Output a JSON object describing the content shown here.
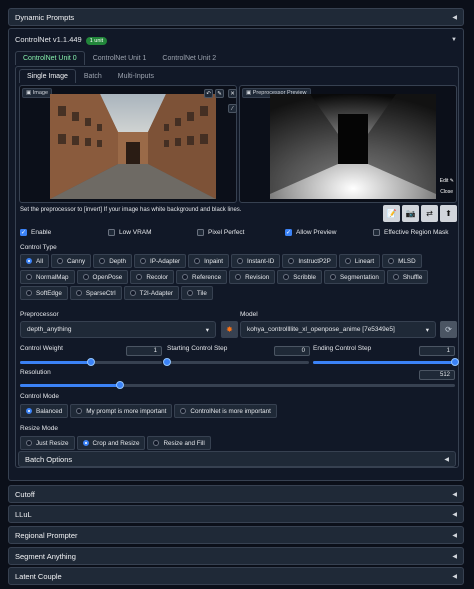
{
  "sections": {
    "dynamic_prompts": "Dynamic Prompts",
    "batch_options": "Batch Options",
    "cutoff": "Cutoff",
    "llul": "LLuL",
    "regional_prompter": "Regional Prompter",
    "segment_anything": "Segment Anything",
    "latent_couple": "Latent Couple"
  },
  "controlnet": {
    "title": "ControlNet v1.1.449",
    "badge": "1 unit",
    "units": [
      "ControlNet Unit 0",
      "ControlNet Unit 1",
      "ControlNet Unit 2"
    ],
    "input_tabs": [
      "Single Image",
      "Batch",
      "Multi-Inputs"
    ],
    "image_label": "Image",
    "preview_label": "Preprocessor Preview",
    "edit_label": "Edit",
    "close_label": "Close",
    "hint": "Set the preprocessor to [invert] If your image has white background and black lines.",
    "checks": {
      "enable": "Enable",
      "low_vram": "Low VRAM",
      "pixel_perfect": "Pixel Perfect",
      "allow_preview": "Allow Preview",
      "effective_region_mask": "Effective Region Mask"
    },
    "control_type_label": "Control Type",
    "control_types": [
      "All",
      "Canny",
      "Depth",
      "IP-Adapter",
      "Inpaint",
      "Instant-ID",
      "InstructP2P",
      "Lineart",
      "MLSD",
      "NormalMap",
      "OpenPose",
      "Recolor",
      "Reference",
      "Revision",
      "Scribble",
      "Segmentation",
      "Shuffle",
      "SoftEdge",
      "SparseCtrl",
      "T2I-Adapter",
      "Tile"
    ],
    "selected_control_type": "All",
    "preprocessor_label": "Preprocessor",
    "preprocessor_value": "depth_anything",
    "model_label": "Model",
    "model_value": "kohya_controllllite_xl_openpose_anime [7e5349e5]",
    "control_weight_label": "Control Weight",
    "control_weight": "1",
    "start_step_label": "Starting Control Step",
    "start_step": "0",
    "end_step_label": "Ending Control Step",
    "end_step": "1",
    "resolution_label": "Resolution",
    "resolution": "512",
    "control_mode_label": "Control Mode",
    "control_modes": [
      "Balanced",
      "My prompt is more important",
      "ControlNet is more important"
    ],
    "resize_mode_label": "Resize Mode",
    "resize_modes": [
      "Just Resize",
      "Crop and Resize",
      "Resize and Fill"
    ],
    "sliders": {
      "control_weight": 0.5,
      "start_step": 0.0,
      "end_step": 1.0,
      "resolution": 0.23
    },
    "accent_color": "#3b82f6"
  }
}
